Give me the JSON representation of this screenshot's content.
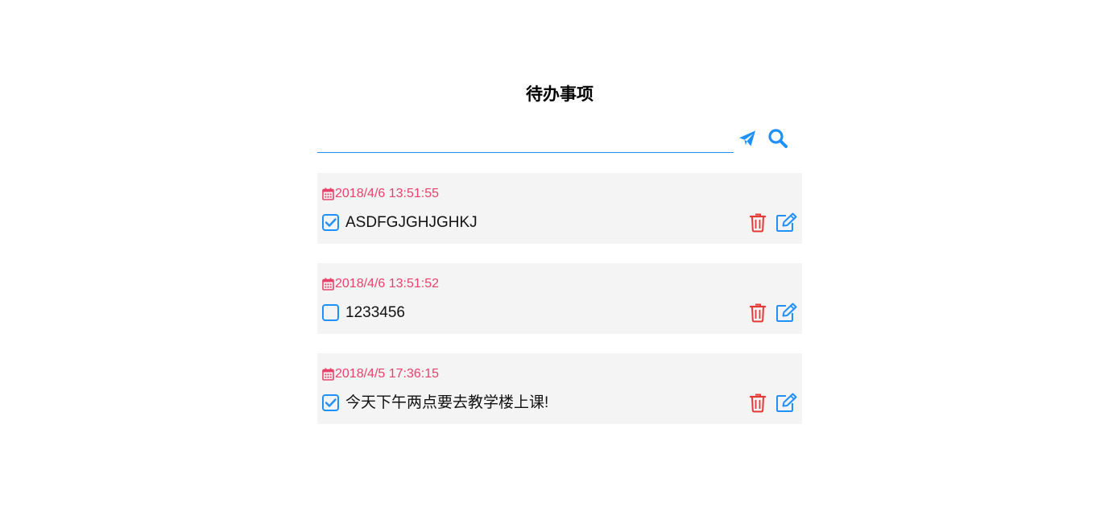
{
  "header": {
    "title": "待办事项"
  },
  "input": {
    "value": "",
    "placeholder": "",
    "send_icon": "send-icon",
    "search_icon": "search-icon"
  },
  "colors": {
    "accent": "#1e90ff",
    "date": "#e8426b",
    "delete": "#e53935",
    "item_background": "#f4f4f4"
  },
  "todos": [
    {
      "date": "2018/4/6 13:51:55",
      "text": "ASDFGJGHJGHKJ",
      "done": true
    },
    {
      "date": "2018/4/6 13:51:52",
      "text": "1233456",
      "done": false
    },
    {
      "date": "2018/4/5 17:36:15",
      "text": "今天下午两点要去教学楼上课!",
      "done": true
    }
  ]
}
